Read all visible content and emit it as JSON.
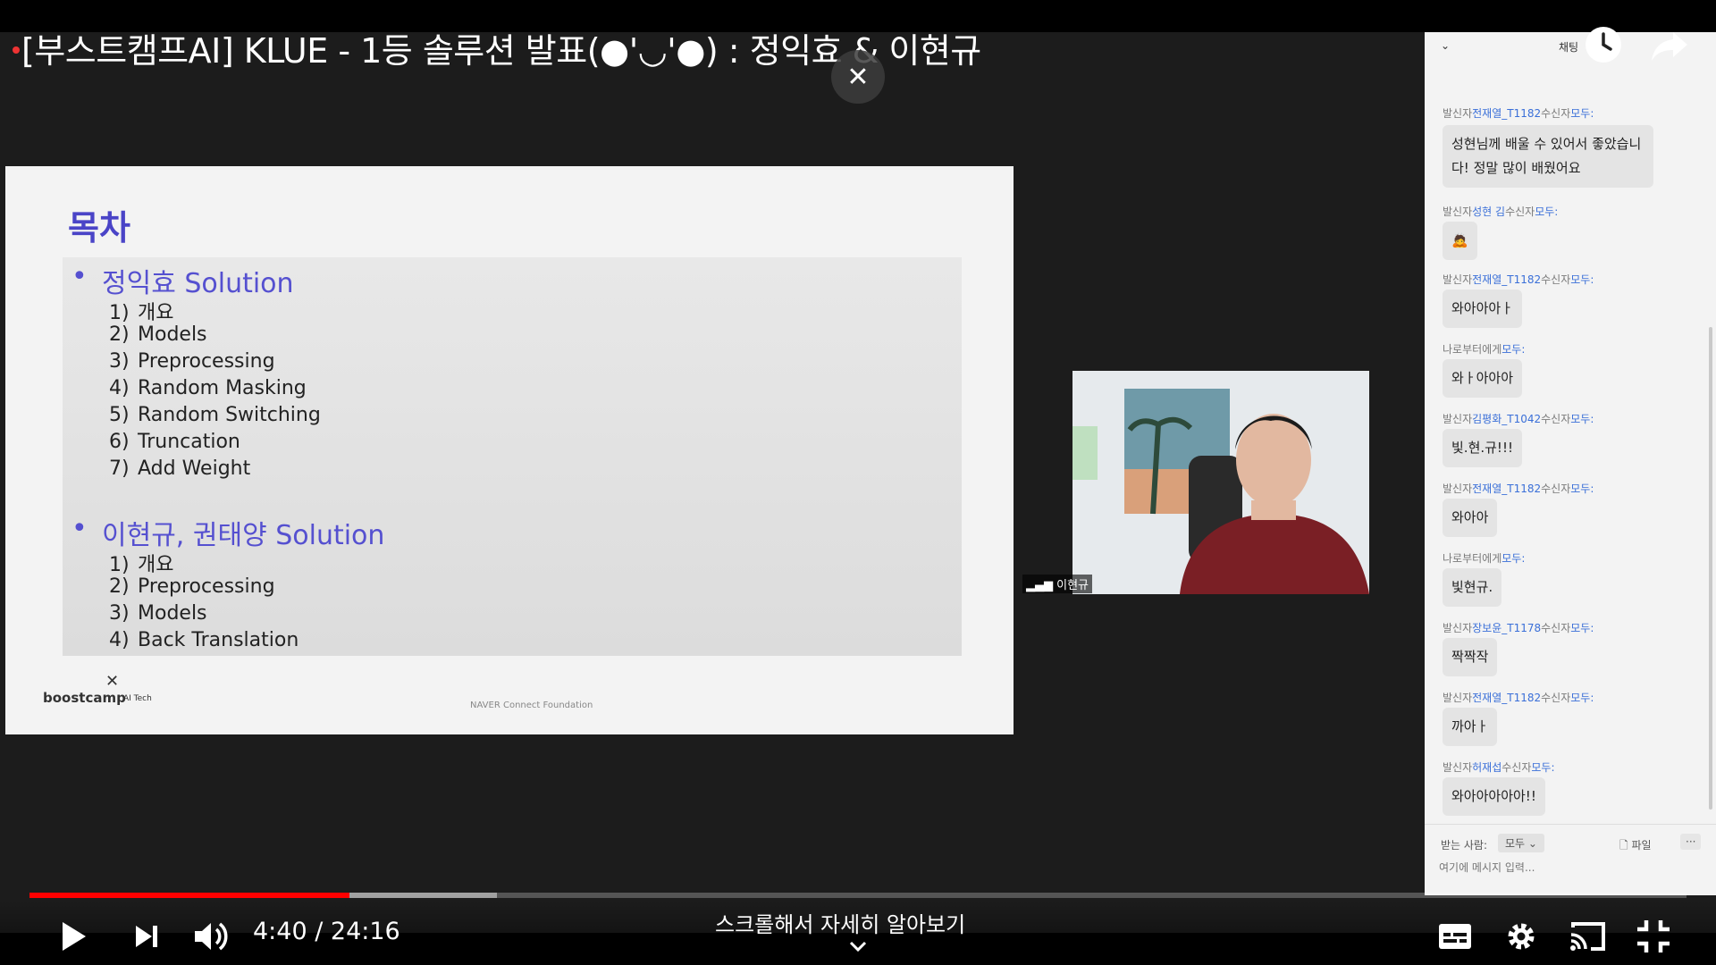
{
  "video": {
    "title": "[부스트캠프AI] KLUE - 1등 솔루션 발표(●'◡'●) : 정익효 & 이현규"
  },
  "slide": {
    "title": "목차",
    "sections": [
      {
        "heading": "정익효 Solution",
        "items": [
          {
            "num": "1)",
            "label": "개요"
          },
          {
            "num": "2)",
            "label": "Models"
          },
          {
            "num": "3)",
            "label": "Preprocessing"
          },
          {
            "num": "4)",
            "label": "Random Masking"
          },
          {
            "num": "5)",
            "label": "Random Switching"
          },
          {
            "num": "6)",
            "label": "Truncation"
          },
          {
            "num": "7)",
            "label": "Add Weight"
          }
        ]
      },
      {
        "heading": "이현규, 권태양 Solution",
        "items": [
          {
            "num": "1)",
            "label": "개요"
          },
          {
            "num": "2)",
            "label": "Preprocessing"
          },
          {
            "num": "3)",
            "label": "Models"
          },
          {
            "num": "4)",
            "label": "Back Translation"
          }
        ]
      }
    ],
    "logo": "boostcamp",
    "logo_sub": "AI Tech",
    "footer": "NAVER Connect Foundation"
  },
  "webcam": {
    "name": "이현규"
  },
  "chat": {
    "header": "채팅",
    "messages": [
      {
        "meta_prefix": "발신자",
        "sender": "전재열_T1182",
        "meta_mid": "수신자",
        "recipient": "모두:",
        "text": "성현님께 배울 수 있어서 좋았습니다! 정말 많이 배웠어요"
      },
      {
        "meta_prefix": "발신자",
        "sender": "성현 김",
        "meta_mid": "수신자",
        "recipient": "모두:",
        "text": "🙇"
      },
      {
        "meta_prefix": "발신자",
        "sender": "전재열_T1182",
        "meta_mid": "수신자",
        "recipient": "모두:",
        "text": "와아아아ㅏ"
      },
      {
        "meta_prefix": "나로부터",
        "sender": "",
        "meta_mid": "에게",
        "recipient": "모두:",
        "text": "와ㅏ아아아"
      },
      {
        "meta_prefix": "발신자",
        "sender": "김평화_T1042",
        "meta_mid": "수신자",
        "recipient": "모두:",
        "text": "빛.현.규!!!"
      },
      {
        "meta_prefix": "발신자",
        "sender": "전재열_T1182",
        "meta_mid": "수신자",
        "recipient": "모두:",
        "text": "와아아"
      },
      {
        "meta_prefix": "나로부터",
        "sender": "",
        "meta_mid": "에게",
        "recipient": "모두:",
        "text": "빛현규."
      },
      {
        "meta_prefix": "발신자",
        "sender": "장보윤_T1178",
        "meta_mid": "수신자",
        "recipient": "모두:",
        "text": "짝짝작"
      },
      {
        "meta_prefix": "발신자",
        "sender": "전재열_T1182",
        "meta_mid": "수신자",
        "recipient": "모두:",
        "text": "까아ㅏ"
      },
      {
        "meta_prefix": "발신자",
        "sender": "허재섭",
        "meta_mid": "수신자",
        "recipient": "모두:",
        "text": "와아아아아아!!"
      }
    ],
    "to_label": "받는 사람:",
    "to_value": "모두",
    "file_label": "파일",
    "input_placeholder": "여기에 메시지 입력..."
  },
  "player": {
    "current_time": "4:40",
    "duration": "24:16",
    "time_display": "4:40 / 24:16",
    "progress_fraction": 0.193,
    "buffered_fraction": 0.282,
    "scroll_hint": "스크롤해서 자세히 알아보기",
    "accent_color": "#ff0000"
  },
  "icons": [
    "play-icon",
    "next-icon",
    "volume-icon",
    "subtitles-icon",
    "settings-icon",
    "cast-icon",
    "exit-fullscreen-icon",
    "watch-later-icon",
    "share-icon",
    "close-icon"
  ]
}
